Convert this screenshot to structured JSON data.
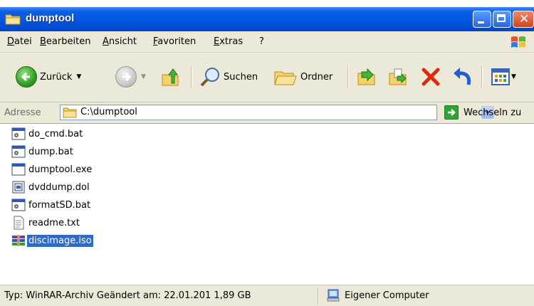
{
  "window": {
    "title": "dumptool"
  },
  "menu": {
    "items": [
      "Datei",
      "Bearbeiten",
      "Ansicht",
      "Favoriten",
      "Extras",
      "?"
    ]
  },
  "toolbar": {
    "back_label": "Zurück",
    "search_label": "Suchen",
    "folders_label": "Ordner"
  },
  "address": {
    "label": "Adresse",
    "path": "C:\\dumptool",
    "go_label": "Wechseln zu"
  },
  "files": [
    {
      "name": "do_cmd.bat",
      "icon": "batch-file-icon"
    },
    {
      "name": "dump.bat",
      "icon": "batch-file-icon"
    },
    {
      "name": "dumptool.exe",
      "icon": "executable-icon"
    },
    {
      "name": "dvddump.dol",
      "icon": "system-file-icon"
    },
    {
      "name": "formatSD.bat",
      "icon": "batch-file-icon"
    },
    {
      "name": "readme.txt",
      "icon": "text-file-icon"
    },
    {
      "name": "discimage.iso",
      "icon": "winrar-archive-icon",
      "selected": true
    }
  ],
  "status": {
    "details": "Typ: WinRAR-Archiv Geändert am: 22.01.201 1,89 GB",
    "location": "Eigener Computer"
  },
  "colors": {
    "titlebar": "#0355e0",
    "selection": "#316ac5",
    "chrome": "#ece9d8"
  }
}
